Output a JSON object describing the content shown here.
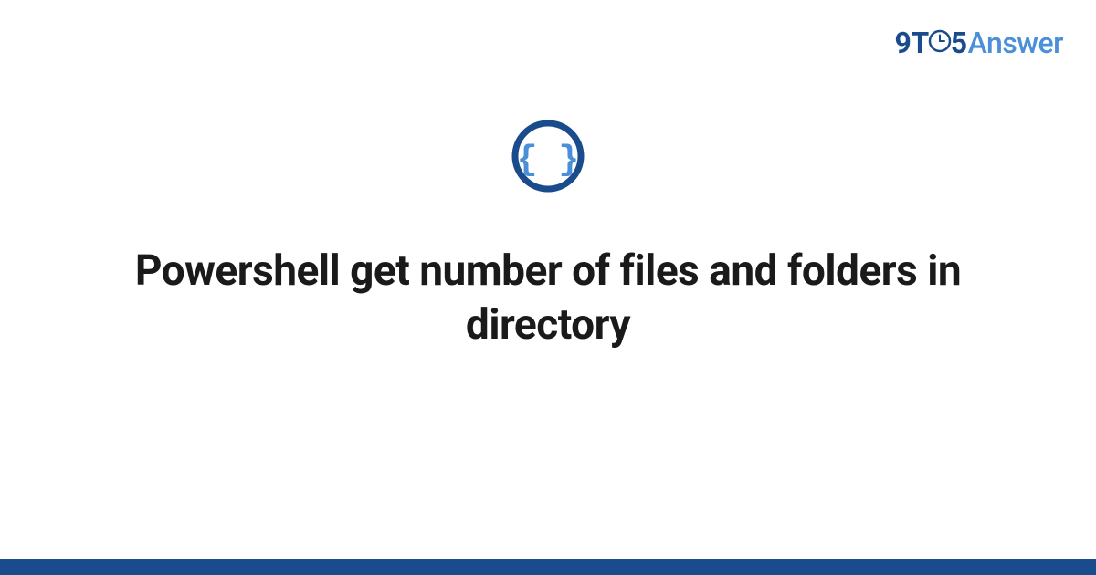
{
  "logo": {
    "part_nine": "9",
    "part_t": "T",
    "part_five": "5",
    "part_answer": "Answer"
  },
  "icon": {
    "label": "code-braces-icon"
  },
  "title": "Powershell get number of files and folders in directory",
  "colors": {
    "brand_dark": "#1a4b8c",
    "brand_light": "#4a8fd8",
    "text": "#1a1a1a"
  }
}
